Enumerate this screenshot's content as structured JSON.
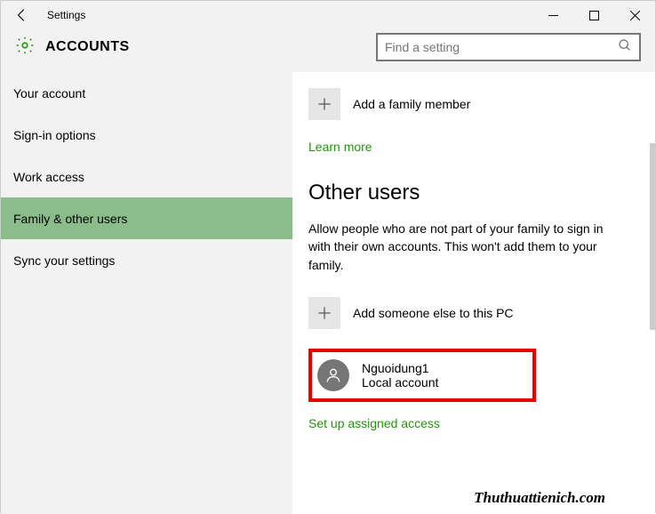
{
  "titlebar": {
    "title": "Settings"
  },
  "header": {
    "app_title": "ACCOUNTS",
    "search_placeholder": "Find a setting"
  },
  "sidebar": {
    "items": [
      {
        "label": "Your account",
        "selected": false
      },
      {
        "label": "Sign-in options",
        "selected": false
      },
      {
        "label": "Work access",
        "selected": false
      },
      {
        "label": "Family & other users",
        "selected": true
      },
      {
        "label": "Sync your settings",
        "selected": false
      }
    ]
  },
  "content": {
    "add_family_label": "Add a family member",
    "learn_more": "Learn more",
    "other_users_title": "Other users",
    "other_users_desc": "Allow people who are not part of your family to sign in with their own accounts. This won't add them to your family.",
    "add_other_label": "Add someone else to this PC",
    "user": {
      "name": "Nguoidung1",
      "type": "Local account"
    },
    "assigned_access": "Set up assigned access"
  },
  "watermark": "Thuthuattienich.com"
}
